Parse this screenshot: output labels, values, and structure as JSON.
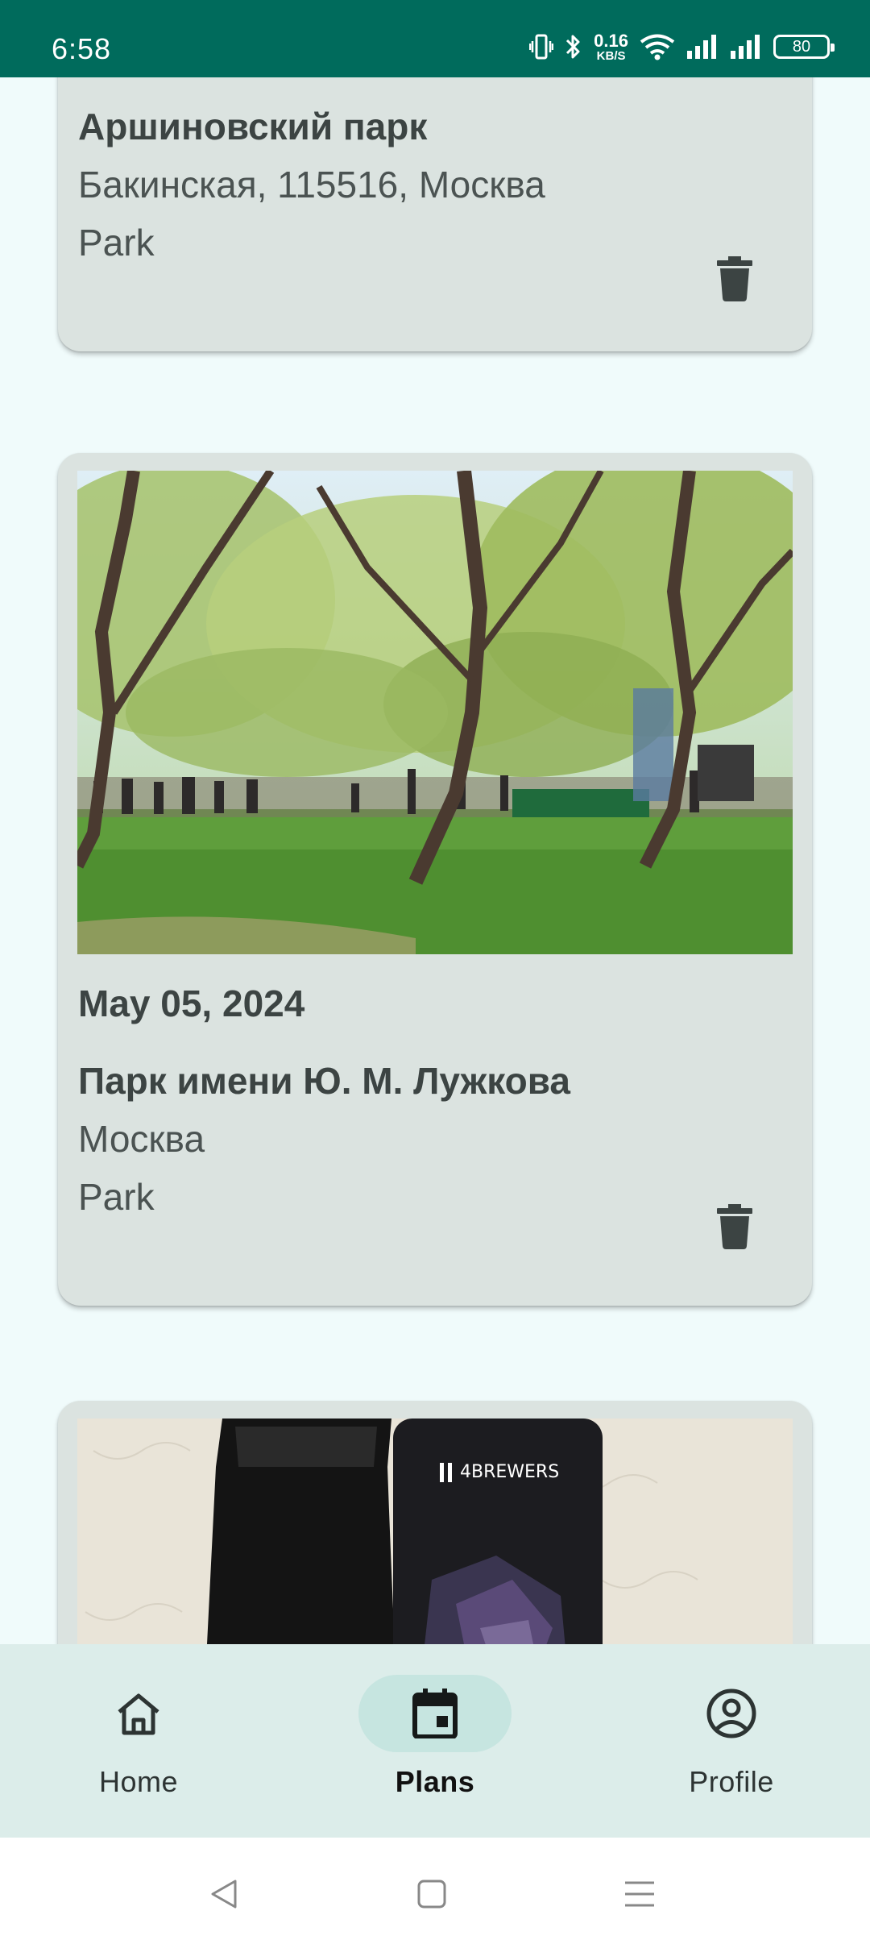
{
  "status_bar": {
    "time": "6:58",
    "net_speed_value": "0.16",
    "net_speed_unit": "KB/S",
    "battery": "80"
  },
  "cards": [
    {
      "place_name": "Аршиновский парк",
      "address": "Бакинская, 115516, Москва",
      "type": "Park",
      "delete_icon": "trash-icon"
    },
    {
      "date": "May 05, 2024",
      "place_name": "Парк имени Ю. М. Лужкова",
      "address": "Москва",
      "type": "Park",
      "delete_icon": "trash-icon"
    },
    {
      "photo_brand_text": "4BREWERS"
    }
  ],
  "bottom_nav": {
    "items": [
      {
        "label": "Home",
        "icon": "home-icon"
      },
      {
        "label": "Plans",
        "icon": "calendar-icon",
        "active": true
      },
      {
        "label": "Profile",
        "icon": "account-circle-icon"
      }
    ]
  },
  "colors": {
    "status_bar": "#006b5c",
    "background": "#f0fbfb",
    "card": "#dbe3e0",
    "nav_bar": "#dcedea",
    "active_pill": "#c6e5e0"
  }
}
